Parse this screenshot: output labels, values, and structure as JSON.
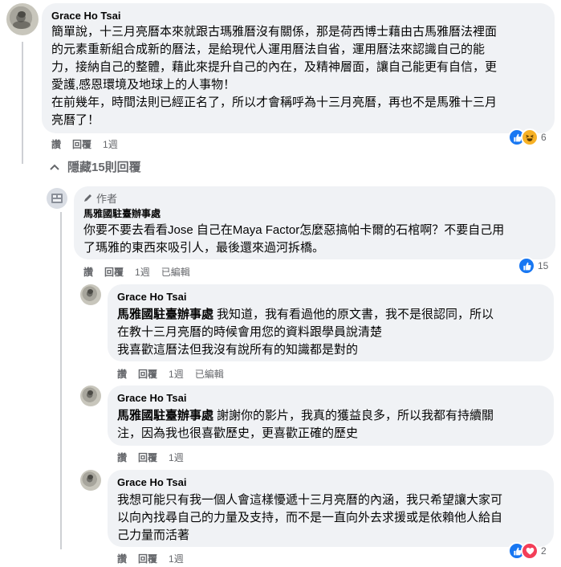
{
  "comments": [
    {
      "author": "Grace Ho Tsai",
      "lines": [
        "簡單說，十三月亮曆本來就跟古瑪雅曆沒有關係，那是荷西博士藉由古馬雅曆法裡面",
        "的元素重新組合成新的曆法，是給現代人運用曆法自省，運用曆法來認識自己的能",
        "力，接納自己的整體，藉此來提升自己的內在，及精神層面，讓自己能更有自信，更",
        "愛護,感恩環境及地球上的人事物！",
        "在前幾年，時間法則已經正名了，所以才會稱呼為十三月亮曆，再也不是馬雅十三月",
        "亮曆了！"
      ],
      "actions": [
        "讚",
        "回覆",
        "1週"
      ],
      "reaction_count": "6"
    }
  ],
  "hide_replies": "隱藏15則回覆",
  "page_reply": {
    "badge": "作者",
    "author": "馬雅國駐臺辦事處",
    "lines": [
      "你要不要去看看Jose 自己在Maya Factor怎麼惡搞帕卡爾的石棺啊？不要自己用",
      "了瑪雅的東西來吸引人，最後還來過河拆橋。"
    ],
    "actions": [
      "讚",
      "回覆",
      "1週",
      "已編輯"
    ],
    "reaction_count": "15"
  },
  "replies": [
    {
      "author": "Grace Ho Tsai",
      "tag": "馬雅國駐臺辦事處",
      "lines": [
        "我知道，我有看過他的原文書，我不是很認同，所以",
        "在教十三月亮曆的時候會用您的資料跟學員說清楚",
        "我喜歡這曆法但我沒有說所有的知識都是對的"
      ],
      "actions": [
        "讚",
        "回覆",
        "1週",
        "已編輯"
      ]
    },
    {
      "author": "Grace Ho Tsai",
      "tag": "馬雅國駐臺辦事處",
      "lines": [
        "謝謝你的影片，我真的獲益良多，所以我都有持續關",
        "注，因為我也很喜歡歷史，更喜歡正確的歷史"
      ],
      "actions": [
        "讚",
        "回覆",
        "1週"
      ]
    },
    {
      "author": "Grace Ho Tsai",
      "lines": [
        "我想可能只有我一個人會這樣懮遞十三月亮曆的內涵，我只希望讓大家可",
        "以向內找尋自己的力量及支持，而不是一直向外去求援或是依賴他人給自",
        "己力量而活著"
      ],
      "actions": [
        "讚",
        "回覆",
        "1週"
      ],
      "reaction_count": "2"
    }
  ],
  "colors": {
    "like": "#1877f2",
    "love": "#f33e58",
    "haha": "#f7b125"
  }
}
